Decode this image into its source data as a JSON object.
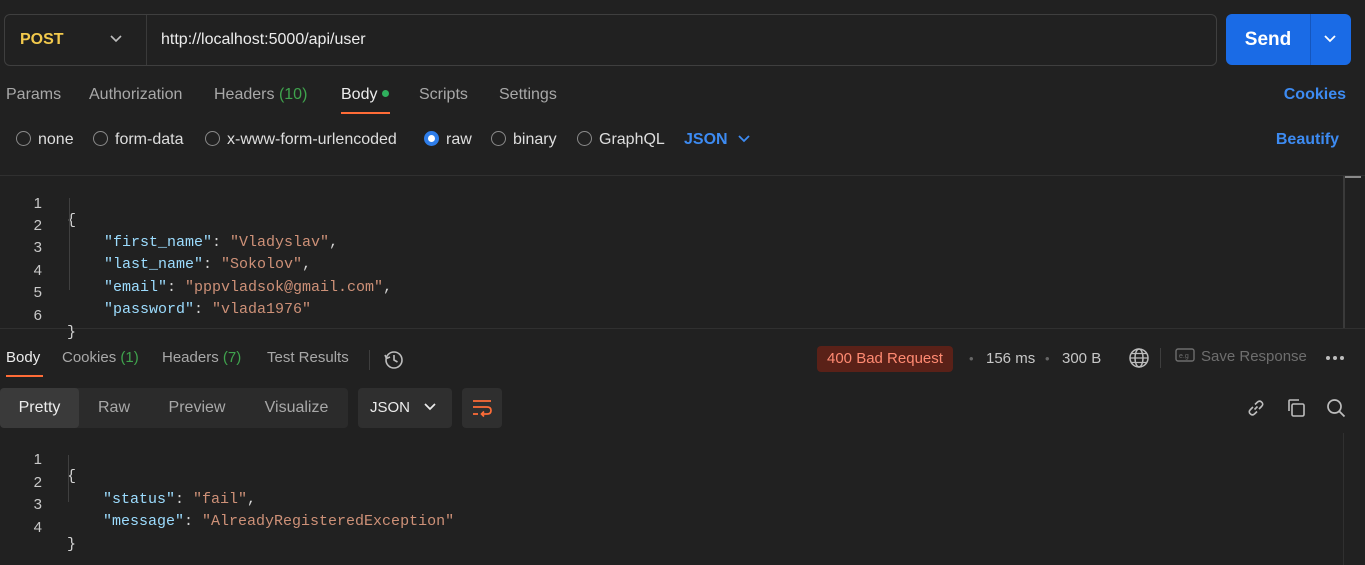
{
  "request": {
    "method": "POST",
    "url": "http://localhost:5000/api/user",
    "send_label": "Send"
  },
  "request_tabs": {
    "params": "Params",
    "authorization": "Authorization",
    "headers": "Headers",
    "headers_count": "(10)",
    "body": "Body",
    "scripts": "Scripts",
    "settings": "Settings",
    "cookies": "Cookies"
  },
  "body_types": {
    "none": "none",
    "form_data": "form-data",
    "urlencoded": "x-www-form-urlencoded",
    "raw": "raw",
    "binary": "binary",
    "graphql": "GraphQL",
    "selected": "raw",
    "language": "JSON",
    "beautify": "Beautify"
  },
  "request_body": {
    "line_numbers": [
      "1",
      "2",
      "3",
      "4",
      "5",
      "6"
    ],
    "open_brace": "{",
    "close_brace": "}",
    "fields": [
      {
        "key": "\"first_name\"",
        "value": "\"Vladyslav\"",
        "sep": ": ",
        "trail": ","
      },
      {
        "key": "\"last_name\"",
        "value": "\"Sokolov\"",
        "sep": ": ",
        "trail": ","
      },
      {
        "key": "\"email\"",
        "value": "\"pppvladsok@gmail.com\"",
        "sep": ": ",
        "trail": ","
      },
      {
        "key": "\"password\"",
        "value": "\"vlada1976\"",
        "sep": ": ",
        "trail": ""
      }
    ]
  },
  "response_tabs": {
    "body": "Body",
    "cookies": "Cookies",
    "cookies_count": "(1)",
    "headers": "Headers",
    "headers_count": "(7)",
    "test_results": "Test Results"
  },
  "response_meta": {
    "status": "400 Bad Request",
    "time": "156 ms",
    "size": "300 B",
    "save_response": "Save Response",
    "bullet": "•",
    "status_color": "#ff8a72"
  },
  "response_view": {
    "pretty": "Pretty",
    "raw": "Raw",
    "preview": "Preview",
    "visualize": "Visualize",
    "format": "JSON"
  },
  "response_body": {
    "line_numbers": [
      "1",
      "2",
      "3",
      "4"
    ],
    "open_brace": "{",
    "close_brace": "}",
    "fields": [
      {
        "key": "\"status\"",
        "value": "\"fail\"",
        "sep": ": ",
        "trail": ","
      },
      {
        "key": "\"message\"",
        "value": "\"AlreadyRegisteredException\"",
        "sep": ": ",
        "trail": ""
      }
    ]
  },
  "colors": {
    "accent": "#ff6c37",
    "primary": "#1a6be6",
    "link": "#3d8bf2",
    "method": "#f2c94c",
    "json_key": "#9cdcfe",
    "json_string": "#ce9178"
  }
}
